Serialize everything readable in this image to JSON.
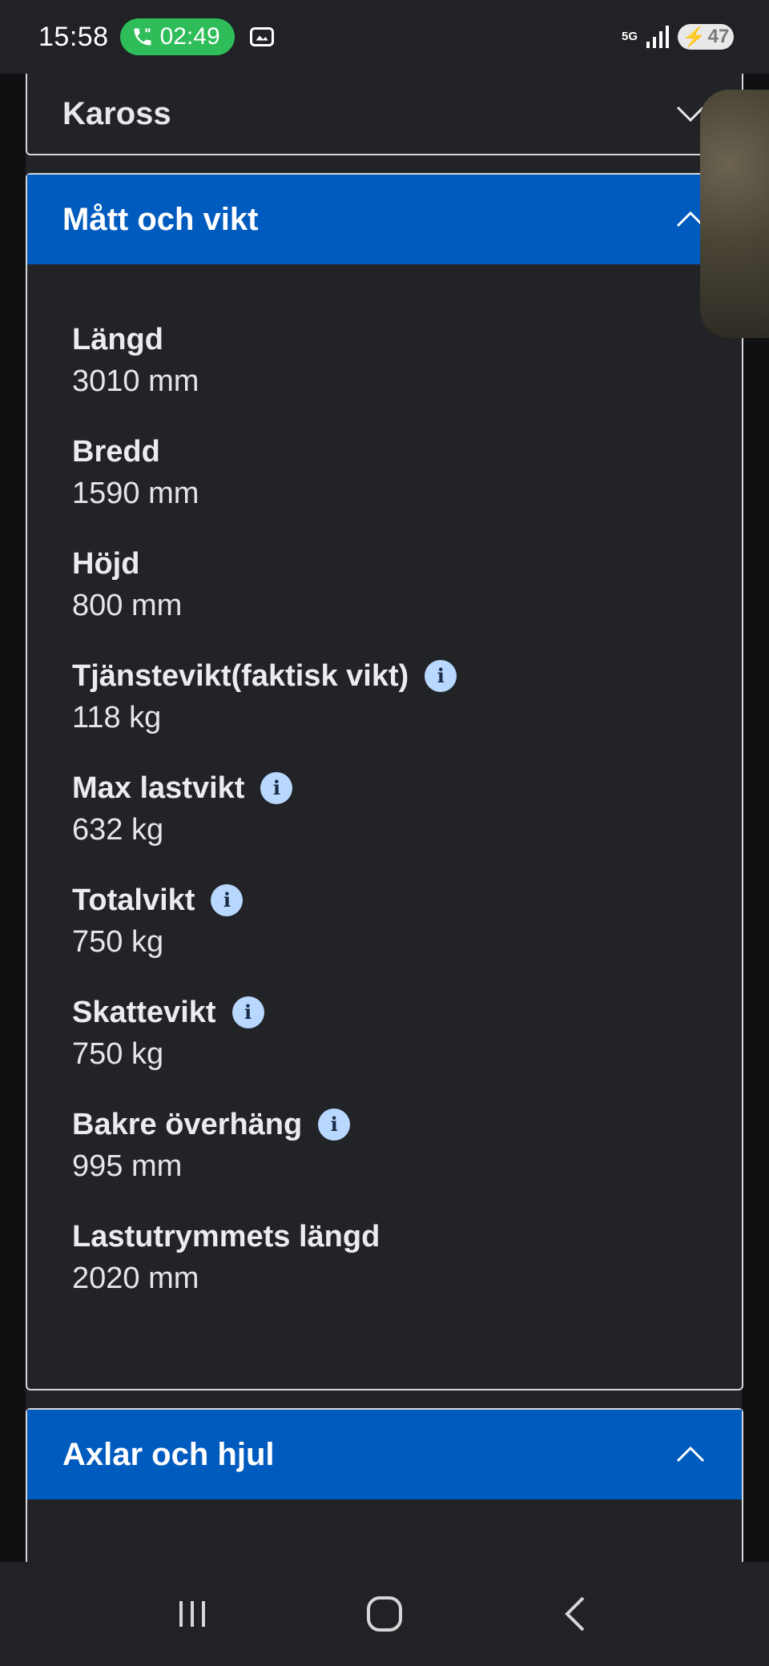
{
  "status_bar": {
    "time": "15:58",
    "call_duration": "02:49",
    "network": "5G",
    "battery": "47",
    "icons": [
      "phone-icon",
      "screenshot-icon",
      "signal-icon",
      "battery-icon"
    ]
  },
  "sections": {
    "kaross": {
      "title": "Kaross",
      "expanded": false
    },
    "matt": {
      "title": "Mått och vikt",
      "expanded": true,
      "specs": [
        {
          "label": "Längd",
          "value": "3010 mm",
          "info": false
        },
        {
          "label": "Bredd",
          "value": "1590 mm",
          "info": false
        },
        {
          "label": "Höjd",
          "value": "800 mm",
          "info": false
        },
        {
          "label": "Tjänstevikt(faktisk vikt)",
          "value": "118 kg",
          "info": true
        },
        {
          "label": "Max lastvikt",
          "value": "632 kg",
          "info": true
        },
        {
          "label": "Totalvikt",
          "value": "750 kg",
          "info": true
        },
        {
          "label": "Skattevikt",
          "value": "750 kg",
          "info": true
        },
        {
          "label": "Bakre överhäng",
          "value": "995 mm",
          "info": true
        },
        {
          "label": "Lastutrymmets längd",
          "value": "2020 mm",
          "info": false
        }
      ]
    },
    "axlar": {
      "title": "Axlar och hjul",
      "expanded": true
    }
  },
  "colors": {
    "accent": "#005bbf",
    "panel": "#222327",
    "info_icon_bg": "#b8d8ff"
  }
}
